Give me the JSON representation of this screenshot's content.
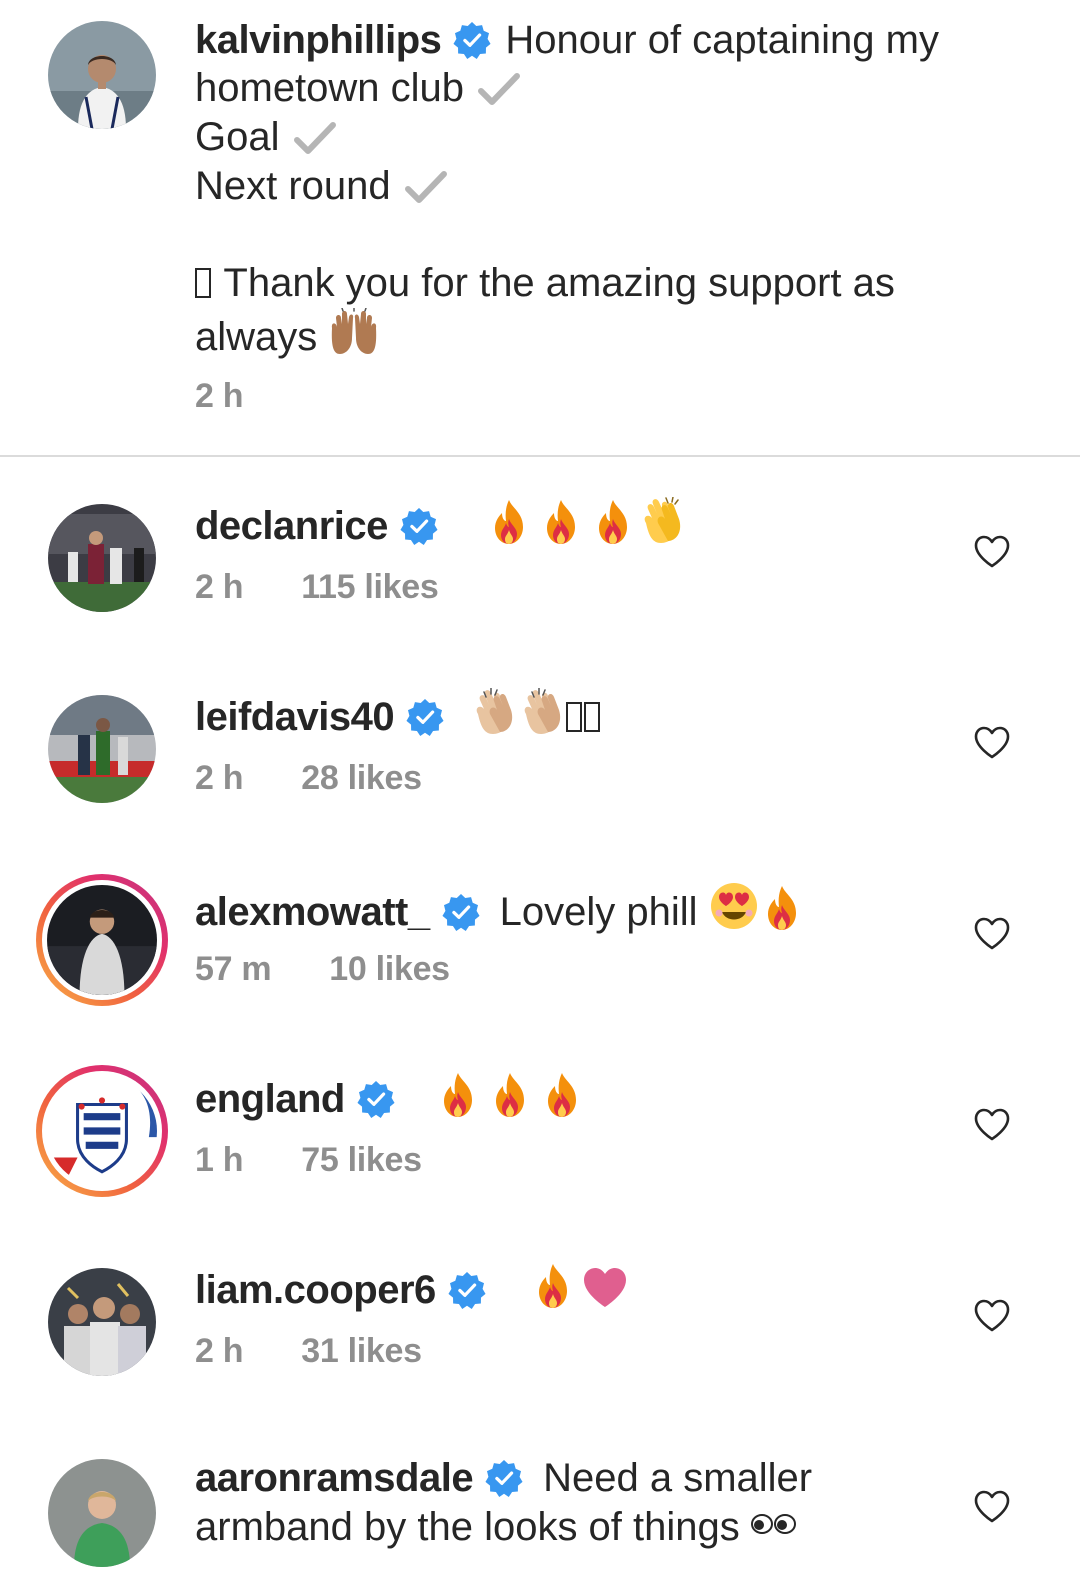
{
  "caption": {
    "username": "kalvinphillips",
    "line1": "Honour of captaining my",
    "line2": "hometown club",
    "line3": "Goal",
    "line4": "Next round",
    "line5": "Thank you for the amazing support as",
    "line6": "always",
    "time": "2 h"
  },
  "comments": [
    {
      "username": "declanrice",
      "text": "",
      "time": "2 h",
      "likes": "115 likes"
    },
    {
      "username": "leifdavis40",
      "text": "",
      "time": "2 h",
      "likes": "28 likes"
    },
    {
      "username": "alexmowatt_",
      "text": "Lovely phill",
      "time": "57 m",
      "likes": "10 likes"
    },
    {
      "username": "england",
      "text": "",
      "time": "1 h",
      "likes": "75 likes"
    },
    {
      "username": "liam.cooper6",
      "text": "",
      "time": "2 h",
      "likes": "31 likes"
    },
    {
      "username": "aaronramsdale",
      "text": "Need a smaller",
      "text2": "armband by the looks of things",
      "time": "",
      "likes": ""
    }
  ],
  "colors": {
    "verified": "#3897f0",
    "muted": "#8e8e8e",
    "text": "#262626"
  }
}
